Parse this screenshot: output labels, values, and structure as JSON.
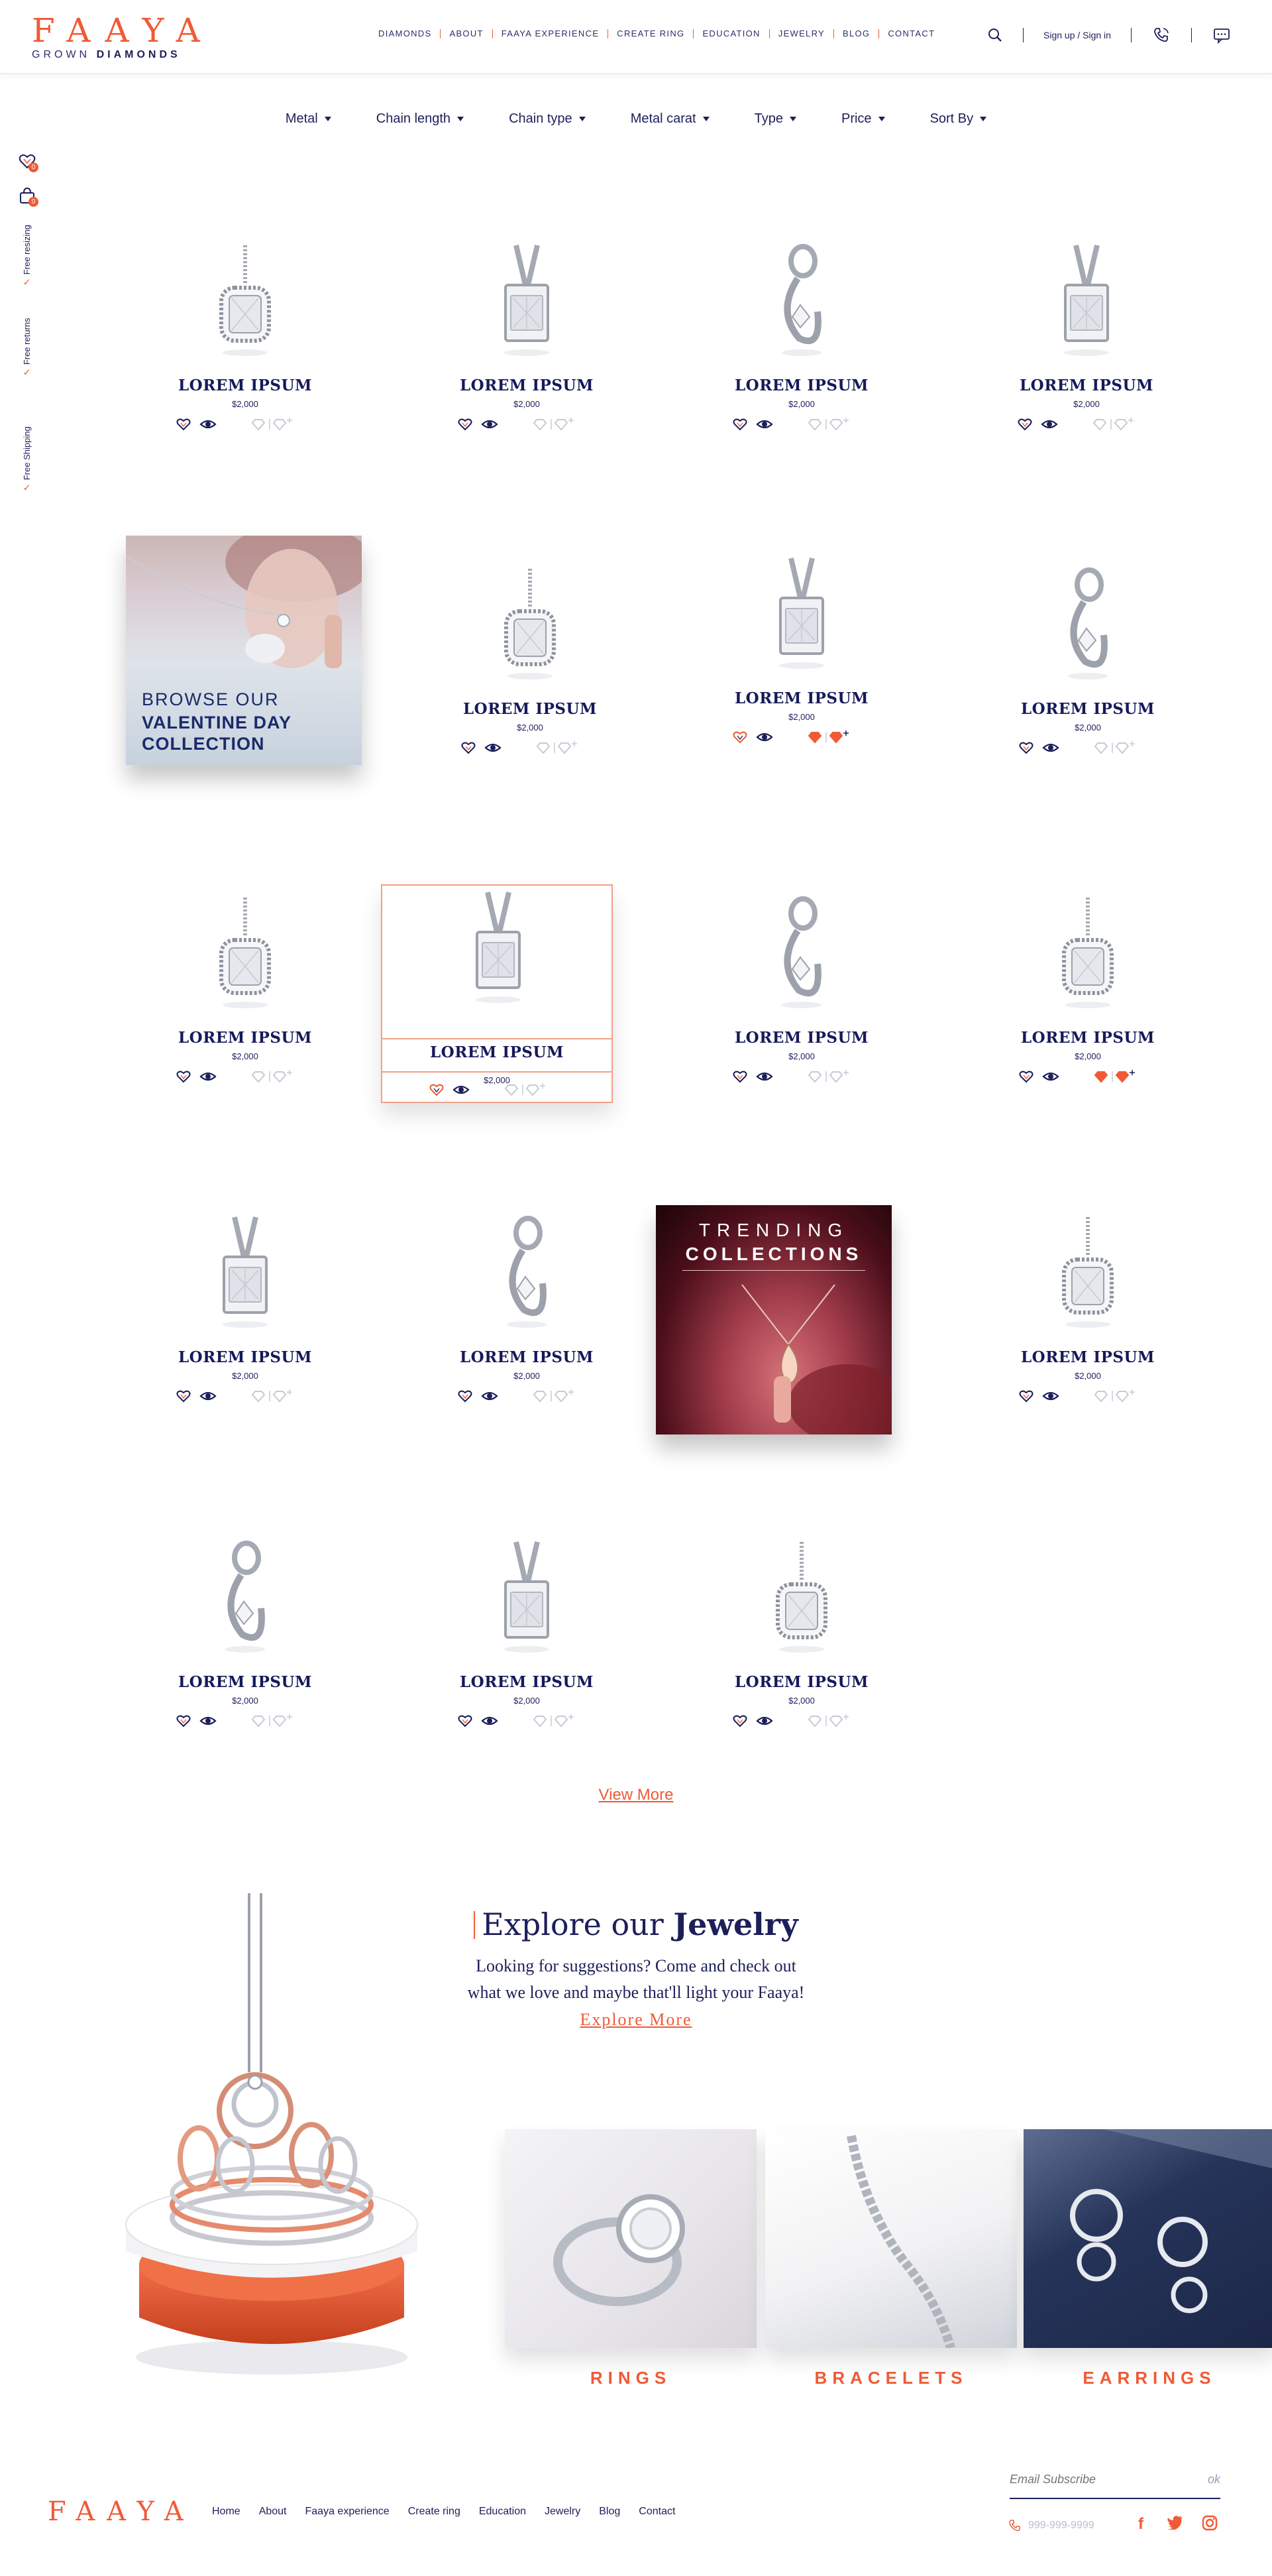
{
  "brand": {
    "name": "FAAYA",
    "sub_prefix": "GROWN",
    "sub_bold": "DIAMONDS"
  },
  "nav": [
    "DIAMONDS",
    "ABOUT",
    "FAAYA EXPERIENCE",
    "CREATE RING",
    "EDUCATION",
    "JEWELRY",
    "BLOG",
    "CONTACT"
  ],
  "header": {
    "sign_label": "Sign up / Sign in"
  },
  "filters": [
    "Metal",
    "Chain length",
    "Chain type",
    "Metal carat",
    "Type",
    "Price",
    "Sort By"
  ],
  "sidebar": {
    "wishlist_count": "0",
    "cart_count": "0",
    "perks": [
      "Free resizing",
      "Free returns",
      "Free Shipping"
    ]
  },
  "products": [
    {
      "name": "LOREM IPSUM",
      "price": "$2,000",
      "shape": "halo"
    },
    {
      "name": "LOREM IPSUM",
      "price": "$2,000",
      "shape": "bar"
    },
    {
      "name": "LOREM IPSUM",
      "price": "$2,000",
      "shape": "swirl"
    },
    {
      "name": "LOREM IPSUM",
      "price": "$2,000",
      "shape": "bar"
    },
    {
      "name": "LOREM IPSUM",
      "price": "$2,000",
      "shape": "halo"
    },
    {
      "name": "LOREM IPSUM",
      "price": "$2,000",
      "shape": "bar"
    },
    {
      "name": "LOREM IPSUM",
      "price": "$2,000",
      "shape": "swirl"
    },
    {
      "name": "LOREM IPSUM",
      "price": "$2,000",
      "shape": "halo"
    },
    {
      "name": "LOREM IPSUM",
      "price": "$2,000",
      "shape": "bar"
    },
    {
      "name": "LOREM IPSUM",
      "price": "$2,000",
      "shape": "swirl"
    },
    {
      "name": "LOREM IPSUM",
      "price": "$2,000",
      "shape": "halo"
    },
    {
      "name": "LOREM IPSUM",
      "price": "$2,000",
      "shape": "bar"
    },
    {
      "name": "LOREM IPSUM",
      "price": "$2,000",
      "shape": "swirl"
    },
    {
      "name": "LOREM IPSUM",
      "price": "$2,000",
      "shape": "halo"
    },
    {
      "name": "LOREM IPSUM",
      "price": "$2,000",
      "shape": "swirl"
    },
    {
      "name": "LOREM IPSUM",
      "price": "$2,000",
      "shape": "bar"
    },
    {
      "name": "LOREM IPSUM",
      "price": "$2,000",
      "shape": "halo"
    }
  ],
  "banners": {
    "valentine": {
      "line1": "BROWSE OUR",
      "line2": "VALENTINE DAY",
      "line3": "COLLECTION"
    },
    "trending": {
      "line1": "TRENDING",
      "line2": "COLLECTIONS"
    }
  },
  "view_more": "View More",
  "explore": {
    "title_regular": "Explore our",
    "title_bold": "Jewelry",
    "line1": "Looking for suggestions? Come and check out",
    "line2": "what we love and maybe that'll light your Faaya!",
    "cta": "Explore More"
  },
  "categories": [
    "RINGS",
    "BRACELETS",
    "EARRINGS"
  ],
  "footer": {
    "links": [
      "Home",
      "About",
      "Faaya experience",
      "Create ring",
      "Education",
      "Jewelry",
      "Blog",
      "Contact"
    ],
    "subscribe_placeholder": "Email Subscribe",
    "subscribe_ok": "ok",
    "phone": "999-999-9999"
  },
  "colors": {
    "accent": "#f05a36",
    "navy": "#1c1f5a",
    "highlight_border": "#f0a089"
  },
  "icons": [
    "search-icon",
    "phone-icon",
    "chat-icon",
    "wishlist-icon",
    "cart-icon",
    "facebook-icon",
    "twitter-icon",
    "instagram-icon"
  ]
}
